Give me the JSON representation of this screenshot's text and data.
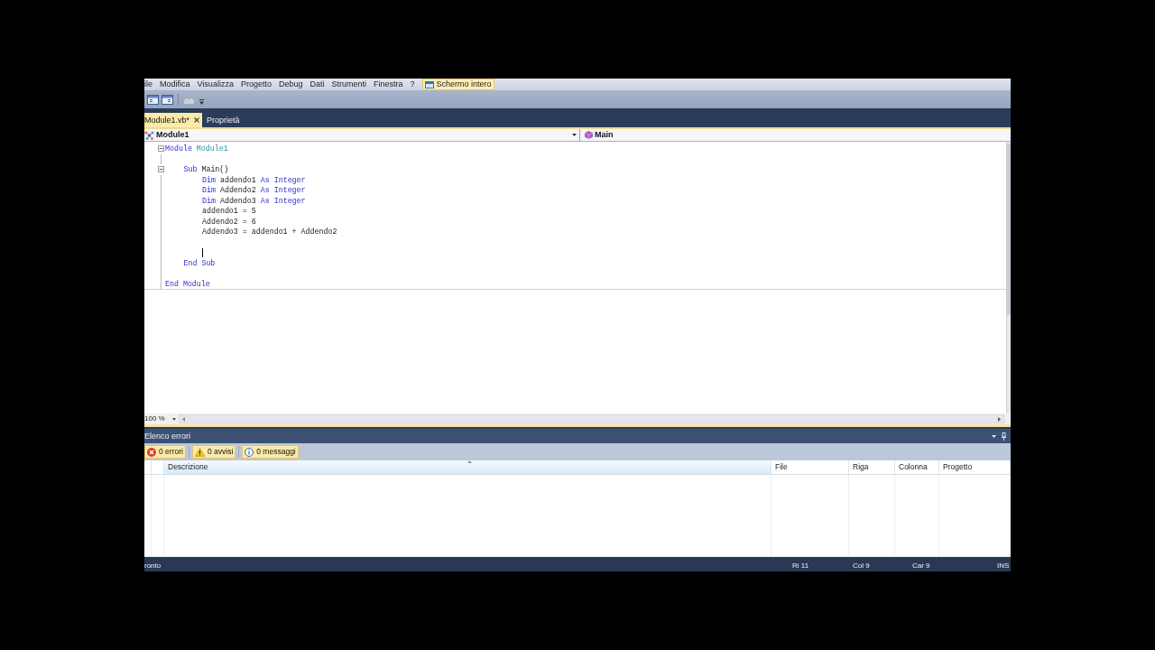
{
  "menu_bar": {
    "items": [
      "ile",
      "Modifica",
      "Visualizza",
      "Progetto",
      "Debug",
      "Dati",
      "Strumenti",
      "Finestra",
      "?"
    ],
    "fullscreen_button": {
      "label": "Schermo intero",
      "on": true
    }
  },
  "toolbar": {
    "buttons": [
      {
        "disabled": false
      },
      {
        "disabled": false
      },
      {
        "disabled": true
      }
    ]
  },
  "tabs": [
    {
      "label": "Module1.vb*",
      "selected": true,
      "closable": true
    },
    {
      "label": "Proprietà",
      "selected": false,
      "closable": false
    }
  ],
  "navigation_bar": {
    "type_dropdown": "Module1",
    "member_dropdown": "Main"
  },
  "code": [
    {
      "kind": "code",
      "caret": false,
      "expanded": true,
      "tokens": [
        {
          "kind": "keyword",
          "text": "Module"
        },
        {
          "kind": "type",
          "text": "Module1"
        }
      ],
      "children": [
        {
          "kind": "blank",
          "caret": false
        },
        {
          "kind": "code",
          "caret": false,
          "expanded": true,
          "tokens": [
            {
              "kind": "keyword",
              "text": "Sub"
            },
            {
              "kind": "plain",
              "text": "Main()"
            }
          ],
          "children": [
            {
              "kind": "code",
              "caret": false,
              "tokens": [
                {
                  "kind": "keyword",
                  "text": "Dim"
                },
                {
                  "kind": "plain",
                  "text": "addendo1"
                },
                {
                  "kind": "keyword",
                  "text": "As"
                },
                {
                  "kind": "keyword",
                  "text": "Integer"
                }
              ]
            },
            {
              "kind": "code",
              "caret": false,
              "tokens": [
                {
                  "kind": "keyword",
                  "text": "Dim"
                },
                {
                  "kind": "plain",
                  "text": "Addendo2"
                },
                {
                  "kind": "keyword",
                  "text": "As"
                },
                {
                  "kind": "keyword",
                  "text": "Integer"
                }
              ]
            },
            {
              "kind": "code",
              "caret": false,
              "tokens": [
                {
                  "kind": "keyword",
                  "text": "Dim"
                },
                {
                  "kind": "plain",
                  "text": "Addendo3"
                },
                {
                  "kind": "keyword",
                  "text": "As"
                },
                {
                  "kind": "keyword",
                  "text": "Integer"
                }
              ]
            },
            {
              "kind": "code",
              "caret": false,
              "tokens": [
                {
                  "kind": "plain",
                  "text": "addendo1 = 5"
                }
              ]
            },
            {
              "kind": "code",
              "caret": false,
              "tokens": [
                {
                  "kind": "plain",
                  "text": "Addendo2 = 6"
                }
              ]
            },
            {
              "kind": "code",
              "caret": false,
              "tokens": [
                {
                  "kind": "plain",
                  "text": "Addendo3 = addendo1 + Addendo2"
                }
              ]
            },
            {
              "kind": "blank",
              "caret": false
            },
            {
              "kind": "blank",
              "caret": true
            }
          ]
        },
        {
          "kind": "code",
          "caret": false,
          "tokens": [
            {
              "kind": "keyword",
              "text": "End Sub"
            }
          ]
        },
        {
          "kind": "blank",
          "caret": false
        }
      ]
    },
    {
      "kind": "code",
      "caret": false,
      "tokens": [
        {
          "kind": "keyword",
          "text": "End Module"
        }
      ]
    }
  ],
  "editor_zoom": "100 %",
  "error_list": {
    "title": "Elenco errori",
    "filters": [
      {
        "kind": "error",
        "label": "0 errori",
        "selected": true
      },
      {
        "kind": "warning",
        "label": "0 avvisi",
        "selected": true
      },
      {
        "kind": "info",
        "label": "0 messaggi",
        "selected": true
      }
    ],
    "columns": [
      {
        "label": "Descrizione",
        "sorted": true
      },
      {
        "label": "File",
        "sorted": false
      },
      {
        "label": "Riga",
        "sorted": false
      },
      {
        "label": "Colonna",
        "sorted": false
      },
      {
        "label": "Progetto",
        "sorted": false
      }
    ]
  },
  "status_bar": {
    "message": "ronto",
    "line": "Ri 11",
    "column": "Col 9",
    "character": "Car 9",
    "mode": "INS"
  }
}
